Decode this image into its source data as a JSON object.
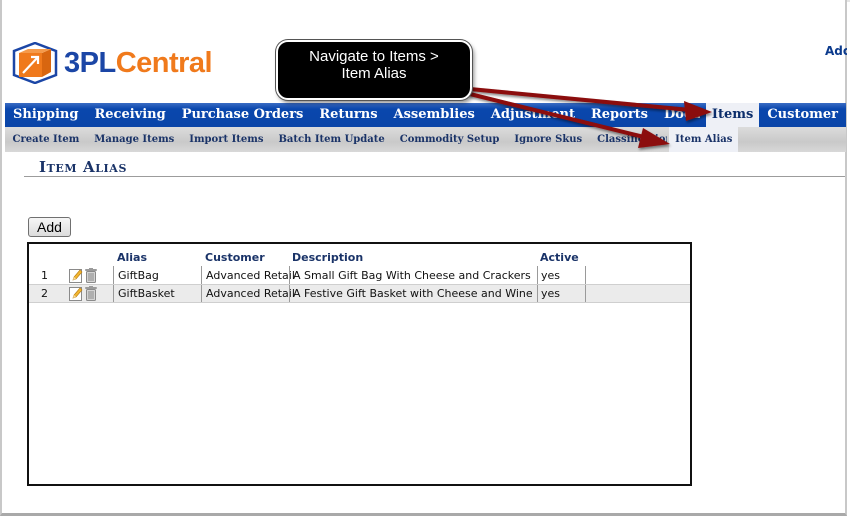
{
  "app": {
    "brand_part1": "3PL",
    "brand_part2": "Central",
    "top_right_link": "Adc"
  },
  "main_nav": {
    "items": [
      {
        "label": "Shipping",
        "active": false
      },
      {
        "label": "Receiving",
        "active": false
      },
      {
        "label": "Purchase Orders",
        "active": false
      },
      {
        "label": "Returns",
        "active": false
      },
      {
        "label": "Assemblies",
        "active": false
      },
      {
        "label": "Adjustment",
        "active": false
      },
      {
        "label": "Reports",
        "active": false
      },
      {
        "label": "Documents",
        "active": false
      },
      {
        "label": "Items",
        "active": true
      },
      {
        "label": "Customer",
        "active": false
      }
    ]
  },
  "sub_nav": {
    "items": [
      {
        "label": "Create Item",
        "active": false
      },
      {
        "label": "Manage Items",
        "active": false
      },
      {
        "label": "Import Items",
        "active": false
      },
      {
        "label": "Batch Item Update",
        "active": false
      },
      {
        "label": "Commodity Setup",
        "active": false
      },
      {
        "label": "Ignore Skus",
        "active": false
      },
      {
        "label": "Classifications",
        "active": false
      },
      {
        "label": "Item Alias",
        "active": true
      }
    ]
  },
  "page": {
    "title": "Item Alias",
    "add_button": "Add"
  },
  "table": {
    "columns": [
      "",
      "",
      "Alias",
      "Customer",
      "Description",
      "Active"
    ],
    "rows": [
      {
        "num": "1",
        "alias": "GiftBag",
        "customer": "Advanced Retail",
        "description": "A Small Gift Bag With Cheese and Crackers",
        "active": "yes"
      },
      {
        "num": "2",
        "alias": "GiftBasket",
        "customer": "Advanced Retail",
        "description": "A Festive Gift Basket with Cheese and Wine",
        "active": "yes"
      }
    ],
    "row_icons": [
      "edit-icon",
      "delete-icon"
    ]
  },
  "annotation": {
    "line1": "Navigate to Items >",
    "line2": "Item Alias",
    "arrow_color": "#8b0a0a"
  },
  "colors": {
    "nav_blue": "#0a47ad",
    "brand_blue": "#1b46a6",
    "brand_orange": "#f07a1c",
    "heading_navy": "#1a3368"
  }
}
